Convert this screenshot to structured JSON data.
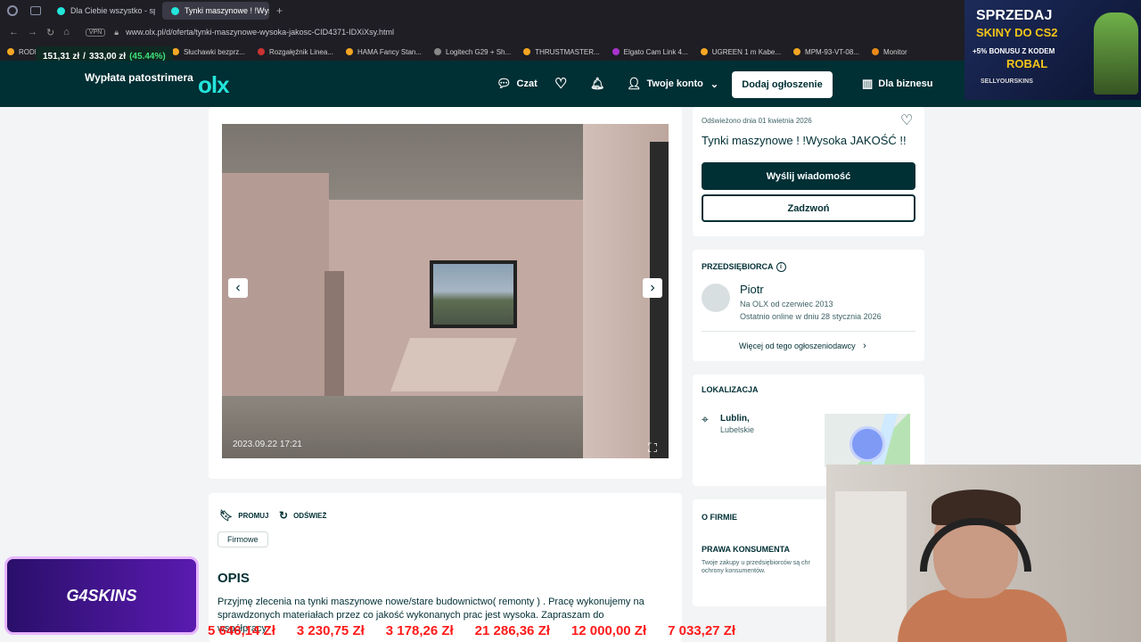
{
  "browser": {
    "tabs": [
      {
        "label": "Dla Ciebie wszystko - spra"
      },
      {
        "label": "Tynki maszynowe ! !Wyso"
      }
    ],
    "vpn_label": "VPN",
    "url": "www.olx.pl/d/oferta/tynki-maszynowe-wysoka-jakosc-CID4371-IDXiXsy.html",
    "bookmarks": [
      "RODE Wireless",
      "Słuchawki bezprz...",
      "Rozgałęźnik Linea...",
      "HAMA Fancy Stan...",
      "Logitech G29 + Sh...",
      "THRUSTMASTER...",
      "Elgato Cam Link 4...",
      "UGREEN 1 m Kabe...",
      "MPM-93-VT-08...",
      "Monitor"
    ]
  },
  "overlay_bar": {
    "current": "151,31 zł",
    "sep": "/",
    "goal": "333,00 zł",
    "percent": "(45.44%)"
  },
  "header": {
    "payout_label": "Wypłata patostrimera",
    "logo": "olx",
    "chat": "Czat",
    "account": "Twoje konto",
    "add_button": "Dodaj ogłoszenie",
    "business": "Dla biznesu"
  },
  "gallery": {
    "timestamp": "2023.09.22 17:21"
  },
  "listing": {
    "refreshed": "Odświeżono dnia 01 kwietnia 2026",
    "title": "Tynki maszynowe ! !Wysoka JAKOŚĆ !!",
    "send_message": "Wyślij wiadomość",
    "call": "Zadzwoń"
  },
  "seller": {
    "section_label": "PRZEDSIĘBIORCA",
    "name": "Piotr",
    "since": "Na OLX od czerwiec 2013",
    "last_online": "Ostatnio online w dniu 28 stycznia 2026",
    "more_link": "Więcej od tego ogłoszeniodawcy"
  },
  "location": {
    "section_label": "LOKALIZACJA",
    "city": "Lublin,",
    "region": "Lubelskie"
  },
  "company": {
    "section_label": "O FIRMIE",
    "consumer_rights": "PRAWA KONSUMENTA",
    "consumer_text": "Twoje zakupy u przedsiębiorców są chr ochrony konsumentów."
  },
  "actions": {
    "promote": "PROMUJ",
    "refresh": "ODŚWIEŻ"
  },
  "tag": "Firmowe",
  "description": {
    "heading": "OPIS",
    "text": "Przyjmę zlecenia na tynki maszynowe nowe/stare budownictwo( remonty ) . Pracę wykonujemy na sprawdzonych materiałach przez co jakość wykonanych prac jest wysoka. Zapraszam do współpracy"
  },
  "promo": {
    "line1": "SPRZEDAJ",
    "line2": "SKINY DO CS2",
    "line3": "+5% BONUSU Z KODEM",
    "line4": "ROBAL",
    "line5": "SELLYOURSKINS"
  },
  "g4skins": "G4SKINS",
  "ticker": [
    "5 646,14 Zł",
    "3 230,75 Zł",
    "3 178,26 Zł",
    "21 286,36 Zł",
    "12 000,00 Zł",
    "7 033,27 Zł"
  ],
  "colors": {
    "olx_dark": "#002f34",
    "olx_accent": "#23e5db",
    "ticker_red": "#ff1a1a"
  }
}
